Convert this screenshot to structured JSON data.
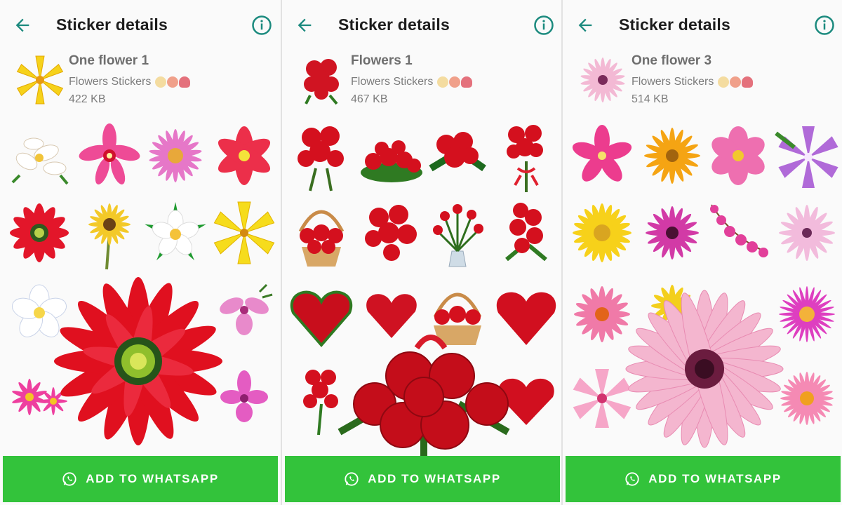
{
  "colors": {
    "accent": "#1b8a7e",
    "button_green": "#33c33b",
    "title_text": "#1d1d1d",
    "secondary_text": "#7c7c7c"
  },
  "panels": [
    {
      "header": {
        "title": "Sticker details",
        "back_icon": "arrow-left-icon",
        "info_icon": "info-circle-icon"
      },
      "pack": {
        "name": "One flower 1",
        "publisher": "Flowers Stickers",
        "size": "422 KB",
        "icon": "yellow-lily"
      },
      "stickers": [
        "white-lilies",
        "pink-orchid",
        "pink-aster",
        "red-lily",
        "red-dahlia",
        "yellow-daisy",
        "white-frangipani",
        "yellow-lily",
        "white-plumeria",
        "red-flower",
        "pink-cattleya",
        "pink-daisies",
        "pink-orchid-2"
      ],
      "preview": "red-dahlia-large",
      "add_button": "ADD TO WHATSAPP"
    },
    {
      "header": {
        "title": "Sticker details",
        "back_icon": "arrow-left-icon",
        "info_icon": "info-circle-icon"
      },
      "pack": {
        "name": "Flowers 1",
        "publisher": "Flowers Stickers",
        "size": "467 KB",
        "icon": "red-rose-bouquet"
      },
      "stickers": [
        "rose-bouquet",
        "rose-pile",
        "rose-posy",
        "rose-ribbon",
        "rose-basket",
        "rose-cluster",
        "rose-vase",
        "rose-tall",
        "rose-heart",
        "rose-heart-small",
        "rose-basket-2",
        "rose-heart-2",
        "rose-bunch",
        "rose-heart-3"
      ],
      "preview": "red-roses-large",
      "add_button": "ADD TO WHATSAPP"
    },
    {
      "header": {
        "title": "Sticker details",
        "back_icon": "arrow-left-icon",
        "info_icon": "info-circle-icon"
      },
      "pack": {
        "name": "One flower 3",
        "publisher": "Flowers Stickers",
        "size": "514 KB",
        "icon": "pink-daisy"
      },
      "stickers": [
        "pink-plumeria",
        "orange-daisy",
        "pink-cosmos",
        "purple-lily",
        "yellow-gerbera",
        "magenta-daisy",
        "pink-orchid-spray",
        "pale-pink-daisy",
        "pink-gerbera",
        "yellow-daisy",
        "pink-daisy",
        "magenta-aster",
        "pink-lily",
        "pink-gerbera-2"
      ],
      "preview": "pink-daisy-large",
      "add_button": "ADD TO WHATSAPP"
    }
  ]
}
